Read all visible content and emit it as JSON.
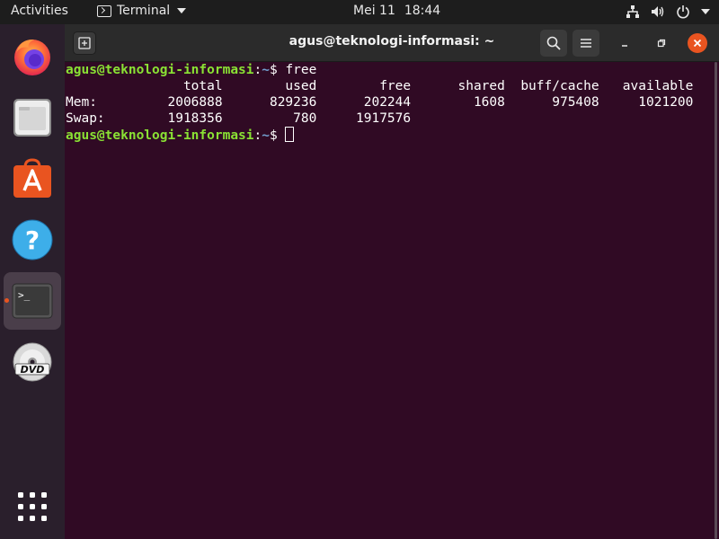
{
  "topbar": {
    "activities": "Activities",
    "app_name": "Terminal",
    "date": "Mei 11",
    "time": "18:44",
    "tray_icons": [
      "network-icon",
      "volume-icon",
      "power-icon",
      "chevron-down-icon"
    ]
  },
  "dock": {
    "items": [
      {
        "name": "firefox",
        "icon": "firefox-icon"
      },
      {
        "name": "files",
        "icon": "files-icon"
      },
      {
        "name": "software",
        "icon": "software-icon"
      },
      {
        "name": "help",
        "icon": "help-icon"
      },
      {
        "name": "terminal",
        "icon": "terminal-icon",
        "active": true,
        "running": true
      },
      {
        "name": "dvd",
        "icon": "dvd-icon"
      }
    ],
    "app_grid_icon": "app-grid-icon"
  },
  "window": {
    "title": "agus@teknologi-informasi: ~"
  },
  "terminal": {
    "prompt_user": "agus@teknologi-informasi",
    "prompt_sep": ":",
    "prompt_path": "~",
    "prompt_suffix": "$ ",
    "command": "free",
    "output_lines": [
      "               total        used        free      shared  buff/cache   available",
      "Mem:         2006888      829236      202244        1608      975408     1021200",
      "Swap:        1918356         780     1917576"
    ]
  },
  "colors": {
    "terminal_bg": "#300a24",
    "prompt_user": "#8ae234",
    "prompt_path": "#729fcf",
    "accent": "#e95420"
  }
}
